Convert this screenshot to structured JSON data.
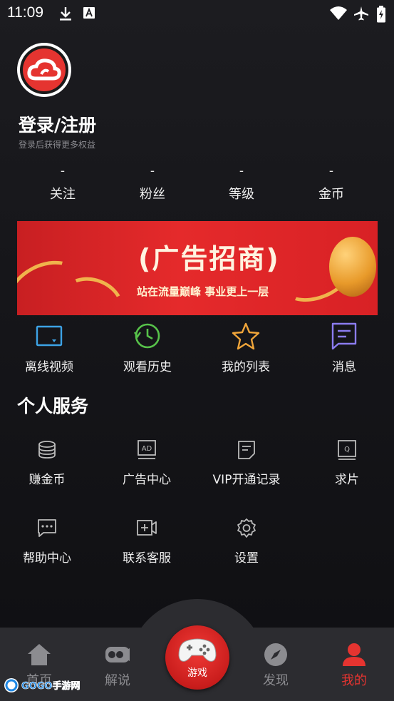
{
  "status_bar": {
    "time": "11:09"
  },
  "profile": {
    "title": "登录/注册",
    "subtitle": "登录后获得更多权益",
    "stats": [
      {
        "value": "-",
        "label": "关注"
      },
      {
        "value": "-",
        "label": "粉丝"
      },
      {
        "value": "-",
        "label": "等级"
      },
      {
        "value": "-",
        "label": "金币"
      }
    ]
  },
  "banner": {
    "title": "(广告招商)",
    "subtitle": "站在流量巅峰   事业更上一层"
  },
  "quick_actions": [
    {
      "label": "离线视频",
      "icon": "offline-video-icon",
      "color": "#3da3e6"
    },
    {
      "label": "观看历史",
      "icon": "history-clock-icon",
      "color": "#57c24a"
    },
    {
      "label": "我的列表",
      "icon": "star-icon",
      "color": "#f0a53a"
    },
    {
      "label": "消息",
      "icon": "message-icon",
      "color": "#8b7cf0"
    }
  ],
  "services": {
    "title": "个人服务",
    "items": [
      {
        "label": "赚金币",
        "icon": "coins-icon"
      },
      {
        "label": "广告中心",
        "icon": "ad-icon"
      },
      {
        "label": "VIP开通记录",
        "icon": "document-icon"
      },
      {
        "label": "求片",
        "icon": "request-icon"
      },
      {
        "label": "帮助中心",
        "icon": "help-chat-icon"
      },
      {
        "label": "联系客服",
        "icon": "contact-service-icon"
      },
      {
        "label": "设置",
        "icon": "settings-gear-icon"
      }
    ]
  },
  "bottom_nav": {
    "items": [
      {
        "label": "首页",
        "icon": "home-icon"
      },
      {
        "label": "解说",
        "icon": "commentary-icon"
      },
      {
        "label": "游戏",
        "icon": "gamepad-icon"
      },
      {
        "label": "发现",
        "icon": "discover-compass-icon"
      },
      {
        "label": "我的",
        "icon": "profile-icon"
      }
    ],
    "active": "我的"
  },
  "watermark": {
    "text": "GOGO手游网"
  },
  "colors": {
    "accent": "#e53430",
    "background": "#16161a",
    "nav_background": "#2c2c30",
    "muted_text": "#8c8c90"
  }
}
